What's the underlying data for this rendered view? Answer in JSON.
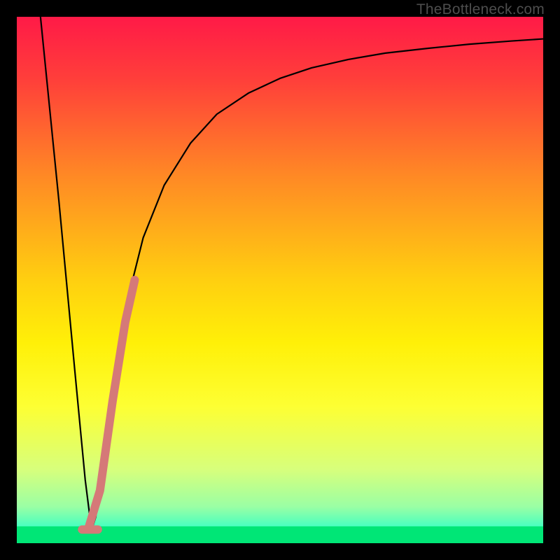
{
  "watermark": "TheBottleneck.com",
  "chart_data": {
    "type": "line",
    "title": "",
    "xlabel": "",
    "ylabel": "",
    "xlim": [
      0,
      100
    ],
    "ylim": [
      0,
      100
    ],
    "grid": false,
    "gradient_stops": [
      {
        "offset": 0.0,
        "color": "#ff1a47"
      },
      {
        "offset": 0.12,
        "color": "#ff3f3a"
      },
      {
        "offset": 0.3,
        "color": "#ff8825"
      },
      {
        "offset": 0.5,
        "color": "#ffcf10"
      },
      {
        "offset": 0.62,
        "color": "#fff008"
      },
      {
        "offset": 0.74,
        "color": "#fdff33"
      },
      {
        "offset": 0.86,
        "color": "#d7ff7c"
      },
      {
        "offset": 0.93,
        "color": "#9bffa4"
      },
      {
        "offset": 0.965,
        "color": "#4fffbd"
      },
      {
        "offset": 0.985,
        "color": "#1affc1"
      },
      {
        "offset": 1.0,
        "color": "#00e676"
      }
    ],
    "series": [
      {
        "name": "bottleneck-curve",
        "stroke": "#000000",
        "stroke_width": 2.2,
        "x": [
          4.5,
          8,
          11,
          13,
          14.2,
          15,
          17,
          19,
          21,
          24,
          28,
          33,
          38,
          44,
          50,
          56,
          63,
          70,
          78,
          86,
          94,
          100
        ],
        "y": [
          100,
          65,
          33,
          12,
          2.5,
          5,
          20,
          34,
          46,
          58,
          68,
          76,
          81.5,
          85.5,
          88.3,
          90.3,
          91.9,
          93.1,
          94.0,
          94.8,
          95.4,
          95.8
        ]
      },
      {
        "name": "highlight-segment",
        "stroke": "#d57978",
        "stroke_width": 12,
        "linecap": "round",
        "x": [
          13.6,
          15.8,
          18.2,
          20.6,
          22.4
        ],
        "y": [
          2.8,
          10.0,
          27.0,
          42.0,
          50.0
        ]
      },
      {
        "name": "highlight-foot",
        "stroke": "#d57978",
        "stroke_width": 12,
        "linecap": "round",
        "x": [
          12.4,
          15.4
        ],
        "y": [
          2.6,
          2.6
        ]
      }
    ],
    "background_band": {
      "y0": 0,
      "y1": 3.2,
      "color": "#00e676"
    }
  }
}
